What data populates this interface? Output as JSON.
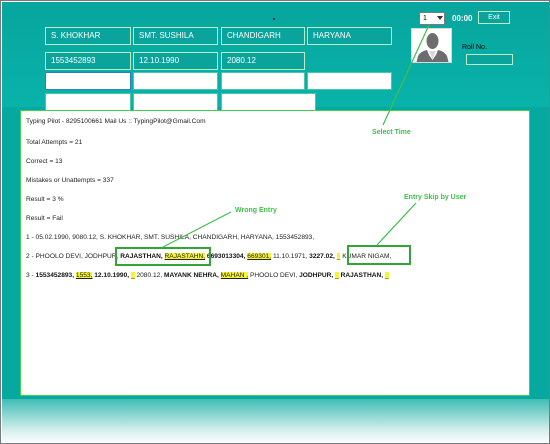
{
  "header_fields": {
    "row1": [
      "S. KHOKHAR",
      "SMT. SUSHILA",
      "CHANDIGARH",
      "HARYANA"
    ],
    "row2": [
      "1553452893",
      "12.10.1990",
      "2080.12"
    ]
  },
  "top_bar": {
    "select_value": "1",
    "timer": "00:00",
    "exit_label": "Exit",
    "roll_label": "Roll No."
  },
  "results": {
    "header_line": "Typing Pilot - 8295100661 Mail Us :: TypingPilot@Gmail.Com",
    "total_attempts": "Total Attempts = 21",
    "correct": "Correct = 13",
    "mistakes": "Mistakes or Unattempts = 337",
    "result_percent": "Result = 3 %",
    "result_status": "Result = Fail",
    "line1": "1 - 05.02.1990, 9080.12, S. KHOKHAR, SMT. SUSHILA, CHANDIGARH, HARYANA, 1553452893,",
    "line2": {
      "prefix": "2 - PHOOLO DEVI, JODHPUR,",
      "s1": "RAJASTHAN,",
      "s2": "RAJASTAHN,",
      "s3": "6693013304,",
      "s4": "669301,",
      "s5": "11.10.1971,",
      "s6": "3227.02,",
      "s7": "_",
      "s8": "KUMAR NIGAM,"
    },
    "line3": {
      "prefix": "3 -",
      "s1": "1553452893,",
      "s2": "1553,",
      "s3": "12.10.1990,",
      "s4": "_",
      "s5": "2080.12,",
      "s6": "MAYANK NEHRA,",
      "s7": "MAHAN ,",
      "s8": "PHOOLO DEVI,",
      "s9": "JODHPUR,",
      "s10": "_",
      "s11": "RAJASTHAN,",
      "s12": "_"
    }
  },
  "annotations": {
    "select_time": "Select Time",
    "wrong_entry": "Wrong Entry",
    "entry_skip": "Entry Skip by User"
  },
  "colors": {
    "teal_background": "#05a99f",
    "field_border": "#b7efc0",
    "annotation_green": "#3fc04a",
    "highlight_yellow": "#f5f535"
  }
}
